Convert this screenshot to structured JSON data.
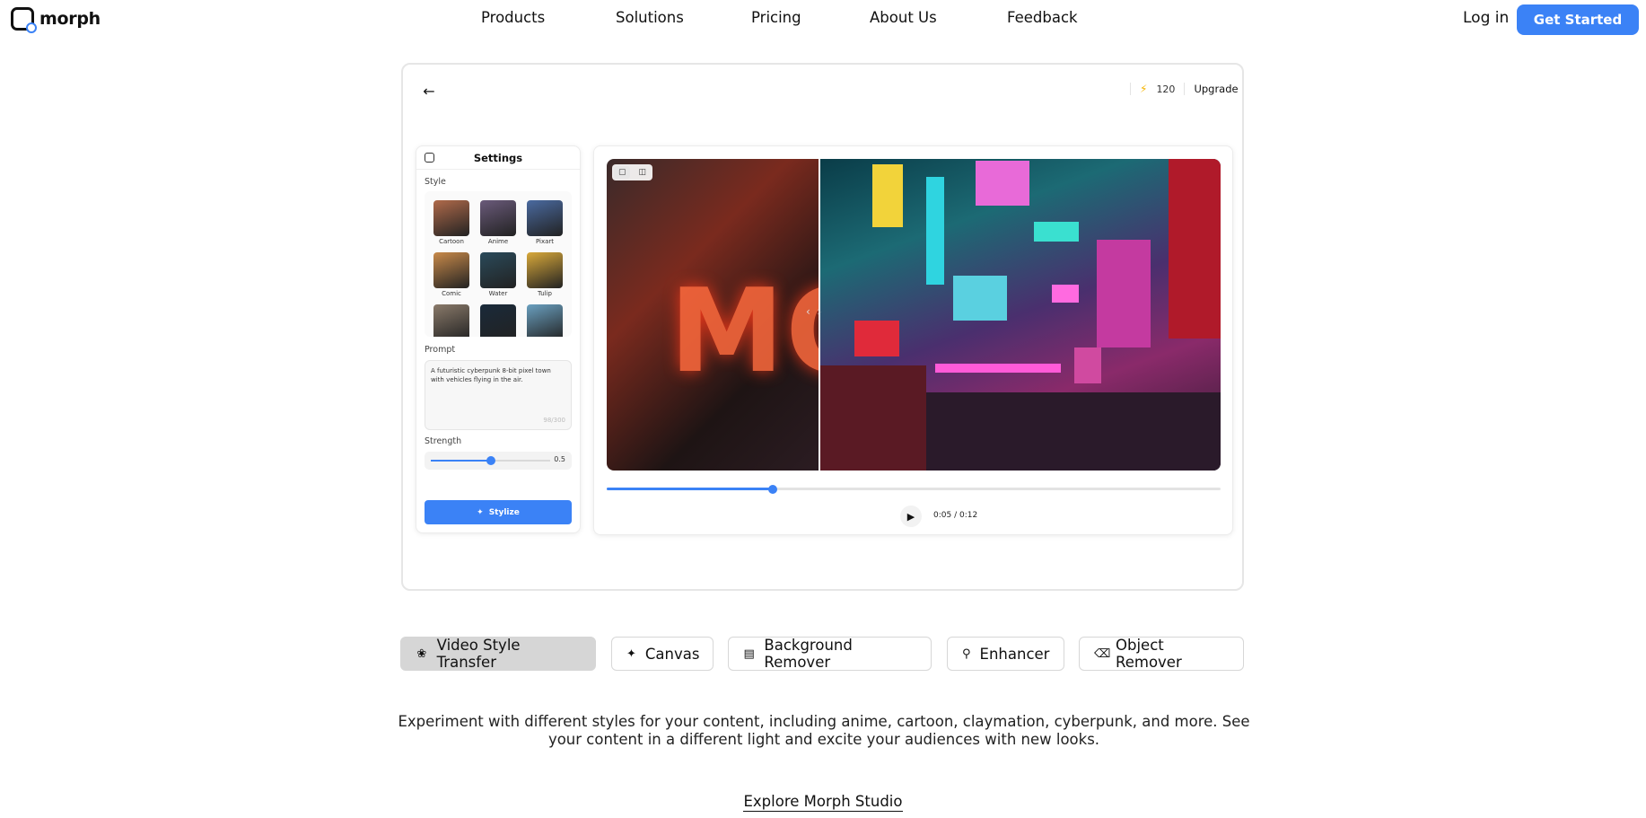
{
  "brand": {
    "name": "morph"
  },
  "nav": {
    "items": [
      {
        "label": "Products"
      },
      {
        "label": "Solutions"
      },
      {
        "label": "Pricing"
      },
      {
        "label": "About Us"
      },
      {
        "label": "Feedback"
      }
    ],
    "login": "Log in",
    "cta": "Get Started"
  },
  "app": {
    "credits": "120",
    "upgrade": "Upgrade",
    "settings": {
      "title": "Settings",
      "style_label": "Style",
      "styles": [
        {
          "label": "Cartoon",
          "color": "#b06a4a"
        },
        {
          "label": "Anime",
          "color": "#6a5a7a"
        },
        {
          "label": "Pixart",
          "color": "#4a6aa0"
        },
        {
          "label": "Comic",
          "color": "#c98a4a"
        },
        {
          "label": "Water",
          "color": "#2a4a5a"
        },
        {
          "label": "Tulip",
          "color": "#d9a93a"
        },
        {
          "label": "",
          "color": "#8a7a6a"
        },
        {
          "label": "",
          "color": "#1a2a3a"
        },
        {
          "label": "",
          "color": "#6aa0c0"
        }
      ],
      "prompt_label": "Prompt",
      "prompt_text": "A futuristic cyberpunk 8-bit pixel town with vehicles flying in the air.",
      "prompt_count": "98/300",
      "strength_label": "Strength",
      "strength_value": "0.5",
      "stylize": "Stylize"
    },
    "player": {
      "time": "0:05 / 0:12",
      "progress": 0.27
    }
  },
  "tabs": [
    {
      "label": "Video Style Transfer",
      "icon": "palette-icon",
      "active": true
    },
    {
      "label": "Canvas",
      "icon": "sparkle-icon",
      "active": false
    },
    {
      "label": "Background Remover",
      "icon": "layers-icon",
      "active": false
    },
    {
      "label": "Enhancer",
      "icon": "enhance-icon",
      "active": false
    },
    {
      "label": "Object Remover",
      "icon": "eraser-icon",
      "active": false
    }
  ],
  "description": "Experiment with different styles for your content, including anime, cartoon, claymation, cyberpunk, and more. See your content in a different light and excite your audiences with new looks.",
  "explore": "Explore Morph Studio",
  "colors": {
    "accent": "#3b82f6"
  }
}
